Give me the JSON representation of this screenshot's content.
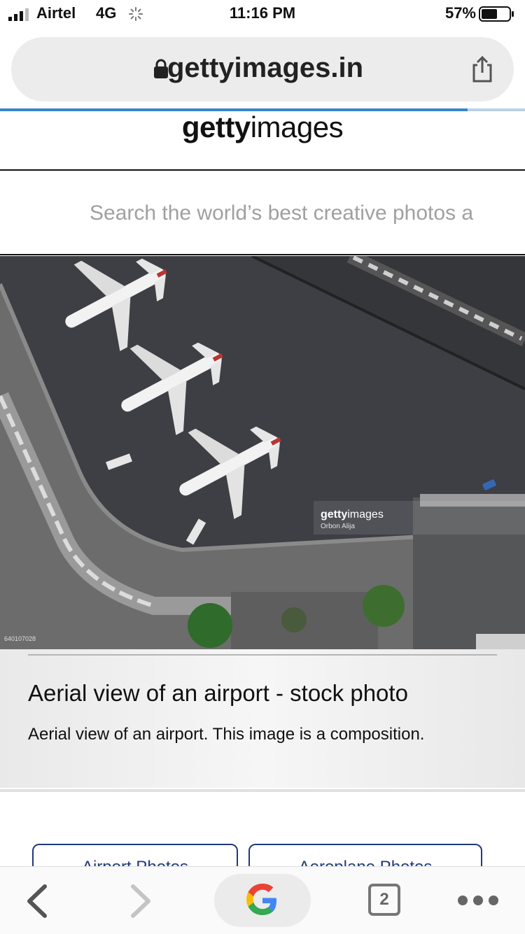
{
  "status_bar": {
    "carrier": "Airtel",
    "network": "4G",
    "time": "11:16 PM",
    "battery_percent": "57%",
    "battery_level": 0.57
  },
  "browser": {
    "url": "gettyimages.in",
    "page_load_progress": 0.89,
    "tab_count": "2"
  },
  "site": {
    "logo_bold": "getty",
    "logo_thin": "images",
    "search_placeholder": "Search the world’s best creative photos a"
  },
  "photo": {
    "watermark_logo_bold": "getty",
    "watermark_logo_thin": "images",
    "watermark_credit": "Orbon Alija",
    "image_id": "640107028"
  },
  "caption": {
    "title": "Aerial view of an airport - stock photo",
    "description": "Aerial view of an airport. This image is a composition."
  },
  "related": [
    {
      "label": "Airport Photos"
    },
    {
      "label": "Aeroplane Photos"
    }
  ],
  "colors": {
    "progress": "#3a85c8",
    "related_border": "#223a7a",
    "tarmac": "#3b3d42"
  }
}
